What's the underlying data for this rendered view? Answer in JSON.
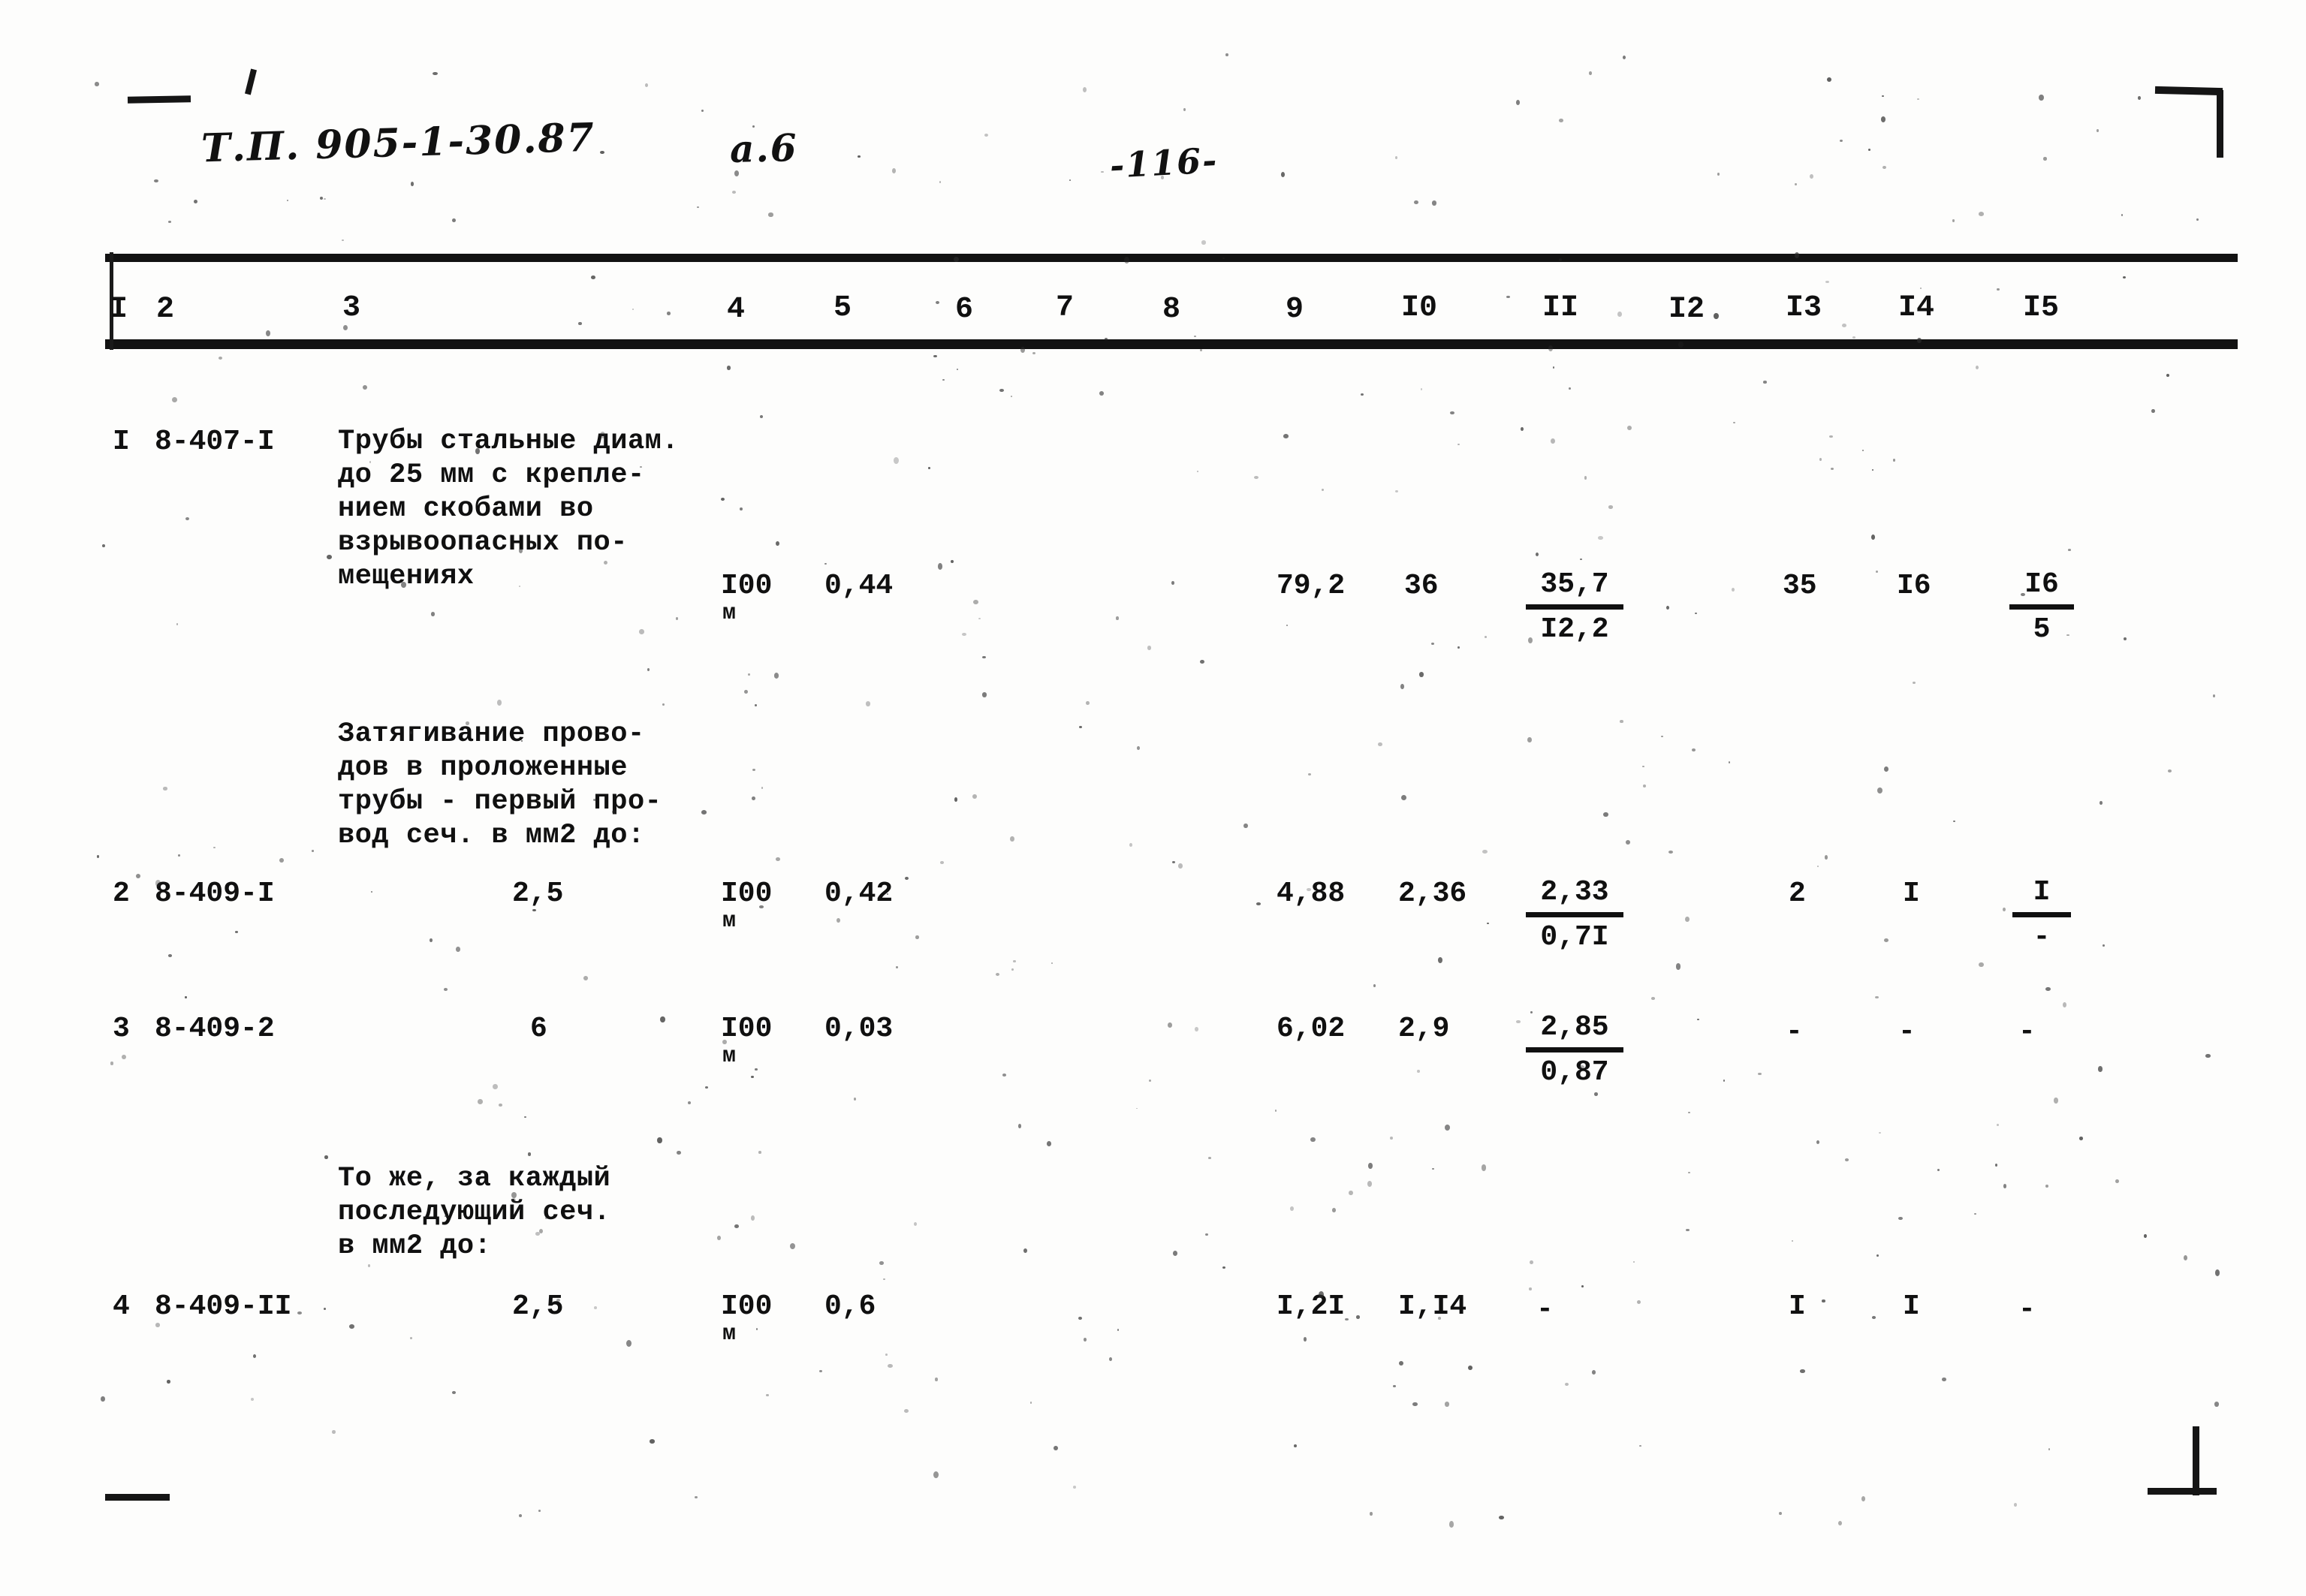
{
  "document": {
    "handwritten_code": "Т.П. 905-1-30.87",
    "handwritten_sheet": "а.6",
    "page_number": "-116-"
  },
  "table": {
    "column_headers": [
      "I",
      "2",
      "3",
      "4",
      "5",
      "6",
      "7",
      "8",
      "9",
      "I0",
      "II",
      "I2",
      "I3",
      "I4",
      "I5"
    ],
    "sections": [
      {
        "type": "row",
        "cells": {
          "c1": "I",
          "c2": "8-407-I",
          "c3": "Трубы стальные диам.\nдо 25 мм с крепле-\nнием скобами во\nвзрывоопасных по-\nмещениях",
          "c4": "I00",
          "c4_unit": "м",
          "c5": "0,44",
          "c6": "",
          "c7": "",
          "c8": "",
          "c9": "79,2",
          "c10": "36",
          "c11_top": "35,7",
          "c11_bot": "I2,2",
          "c12": "",
          "c13": "35",
          "c14": "I6",
          "c15_top": "I6",
          "c15_bot": "5"
        }
      },
      {
        "type": "caption",
        "text": "Затягивание прово-\nдов в проложенные\nтрубы - первый про-\nвод сеч. в мм2 до:"
      },
      {
        "type": "row",
        "cells": {
          "c1": "2",
          "c2": "8-409-I",
          "c3": "2,5",
          "c4": "I00",
          "c4_unit": "м",
          "c5": "0,42",
          "c6": "",
          "c7": "",
          "c8": "",
          "c9": "4,88",
          "c10": "2,36",
          "c11_top": "2,33",
          "c11_bot": "0,7I",
          "c12": "",
          "c13": "2",
          "c14": "I",
          "c15_top": "I",
          "c15_bot": "-"
        }
      },
      {
        "type": "row",
        "cells": {
          "c1": "3",
          "c2": "8-409-2",
          "c3": "6",
          "c4": "I00",
          "c4_unit": "м",
          "c5": "0,03",
          "c6": "",
          "c7": "",
          "c8": "",
          "c9": "6,02",
          "c10": "2,9",
          "c11_top": "2,85",
          "c11_bot": "0,87",
          "c12": "",
          "c13": "-",
          "c14": "-",
          "c15_top": "-",
          "c15_bot": ""
        }
      },
      {
        "type": "caption",
        "text": "То же, за каждый\nпоследующий сеч.\nв мм2 до:"
      },
      {
        "type": "row",
        "cells": {
          "c1": "4",
          "c2": "8-409-II",
          "c3": "2,5",
          "c4": "I00",
          "c4_unit": "м",
          "c5": "0,6",
          "c6": "",
          "c7": "",
          "c8": "",
          "c9": "I,2I",
          "c10": "I,I4",
          "c11_top": "-",
          "c11_bot": "",
          "c12": "",
          "c13": "I",
          "c14": "I",
          "c15_top": "-",
          "c15_bot": ""
        }
      }
    ]
  }
}
